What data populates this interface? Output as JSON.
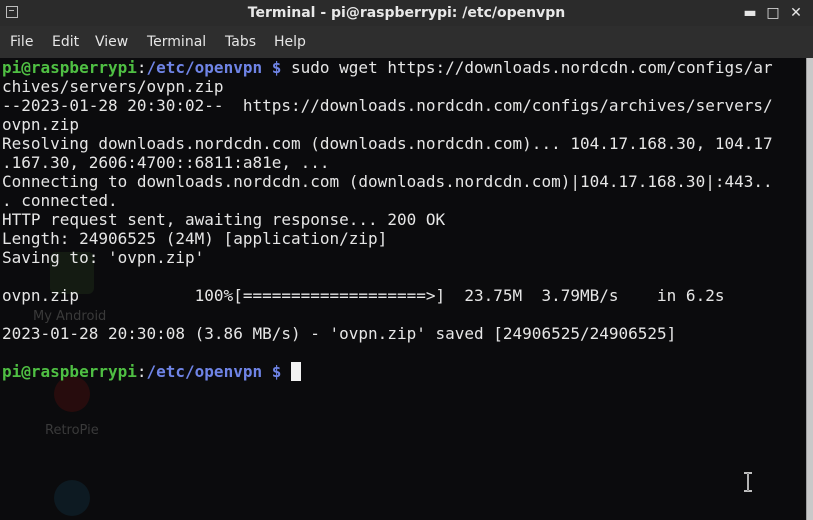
{
  "window": {
    "title": "Terminal - pi@raspberrypi: /etc/openvpn",
    "controls": {
      "minimize": "▬",
      "maximize": "□",
      "close": "✕"
    }
  },
  "menu": [
    "File",
    "Edit",
    "View",
    "Terminal",
    "Tabs",
    "Help"
  ],
  "prompt": {
    "user_host": "pi@raspberrypi",
    "separator": ":",
    "path": "/etc/openvpn",
    "symbol": " $ "
  },
  "terminal": {
    "command": "sudo wget https://downloads.nordcdn.com/configs/ar",
    "output": [
      "chives/servers/ovpn.zip",
      "--2023-01-28 20:30:02--  https://downloads.nordcdn.com/configs/archives/servers/",
      "ovpn.zip",
      "Resolving downloads.nordcdn.com (downloads.nordcdn.com)... 104.17.168.30, 104.17",
      ".167.30, 2606:4700::6811:a81e, ...",
      "Connecting to downloads.nordcdn.com (downloads.nordcdn.com)|104.17.168.30|:443..",
      ". connected.",
      "HTTP request sent, awaiting response... 200 OK",
      "Length: 24906525 (24M) [application/zip]",
      "Saving to: 'ovpn.zip'",
      "",
      "ovpn.zip            100%[===================>]  23.75M  3.79MB/s    in 6.2s",
      "",
      "2023-01-28 20:30:08 (3.86 MB/s) - 'ovpn.zip' saved [24906525/24906525]",
      ""
    ]
  },
  "background_text": {
    "desktop_icon_1": "My Android",
    "desktop_icon_2": "RetroPie"
  }
}
